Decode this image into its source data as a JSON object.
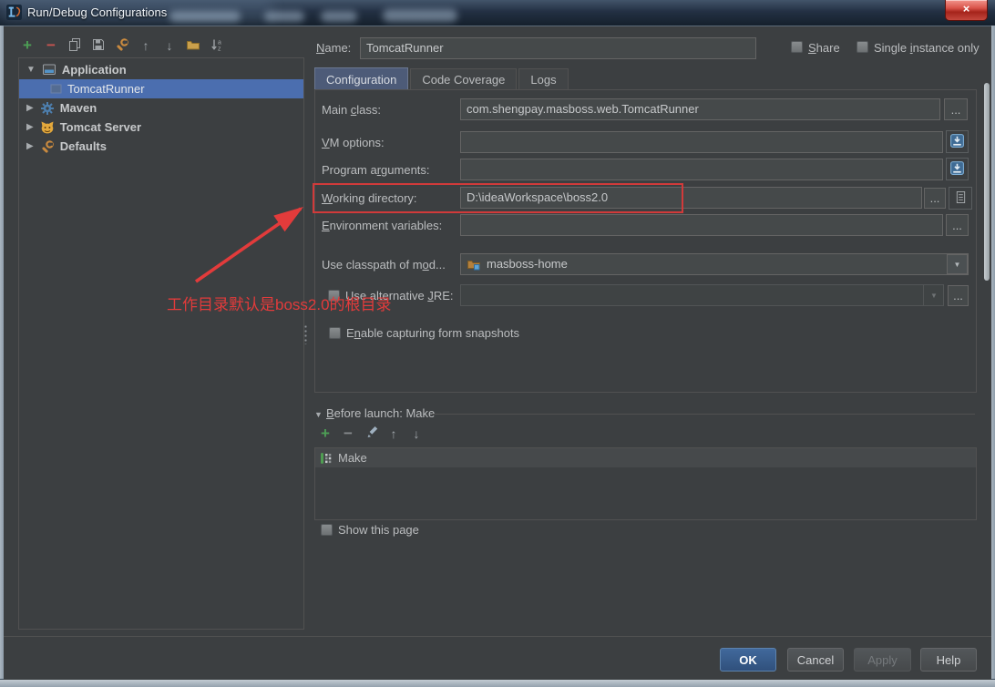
{
  "window": {
    "title": "Run/Debug Configurations"
  },
  "icons": {
    "plus": "+",
    "minus": "−",
    "arrow_up": "↑",
    "arrow_down": "↓",
    "tri_down": "▼",
    "tri_right": "▶",
    "ellipsis": "...",
    "dd_arrow": "▼",
    "close": "×"
  },
  "sidebar": {
    "tree": [
      {
        "label": "Application"
      },
      {
        "label": "TomcatRunner"
      },
      {
        "label": "Maven"
      },
      {
        "label": "Tomcat Server"
      },
      {
        "label": "Defaults"
      }
    ]
  },
  "form": {
    "name": {
      "label": [
        "",
        "N",
        "ame:"
      ],
      "value": "TomcatRunner"
    },
    "share_label": [
      "",
      "S",
      "hare"
    ],
    "single_instance_label": [
      "Single ",
      "i",
      "nstance only"
    ],
    "tabs": [
      {
        "label": "Configuration"
      },
      {
        "label": "Code Coverage"
      },
      {
        "label": "Logs"
      }
    ],
    "main_class": {
      "label": [
        "Main ",
        "c",
        "lass:"
      ],
      "value": "com.shengpay.masboss.web.TomcatRunner"
    },
    "vm_options": {
      "label": [
        "",
        "V",
        "M options:"
      ],
      "value": ""
    },
    "program_arguments": {
      "label": [
        "Program a",
        "r",
        "guments:"
      ],
      "value": ""
    },
    "working_directory": {
      "label": [
        "",
        "W",
        "orking directory:"
      ],
      "value": "D:\\ideaWorkspace\\boss2.0"
    },
    "environment_variables": {
      "label": [
        "",
        "E",
        "nvironment variables:"
      ],
      "value": ""
    },
    "use_classpath": {
      "label": [
        "Use classpath of m",
        "o",
        "d..."
      ],
      "value": "masboss-home"
    },
    "use_alternative_jre": {
      "label": [
        "Use alternative ",
        "J",
        "RE:"
      ],
      "value": ""
    },
    "enable_snapshots_label": [
      "E",
      "n",
      "able capturing form snapshots"
    ],
    "before_launch": {
      "header": [
        "",
        "B",
        "efore launch: Make"
      ],
      "items": [
        {
          "label": "Make"
        }
      ]
    },
    "show_this_page_label": "Show this page"
  },
  "footer": {
    "ok": "OK",
    "cancel": "Cancel",
    "apply": "Apply",
    "help": "Help"
  },
  "annotation": {
    "text": "工作目录默认是boss2.0的根目录"
  },
  "colors": {
    "annotation_red": "#e23b3b",
    "selection_blue": "#4b6eaf",
    "ok_button_blue": "#30507c",
    "dialog_bg": "#3c3f41"
  }
}
